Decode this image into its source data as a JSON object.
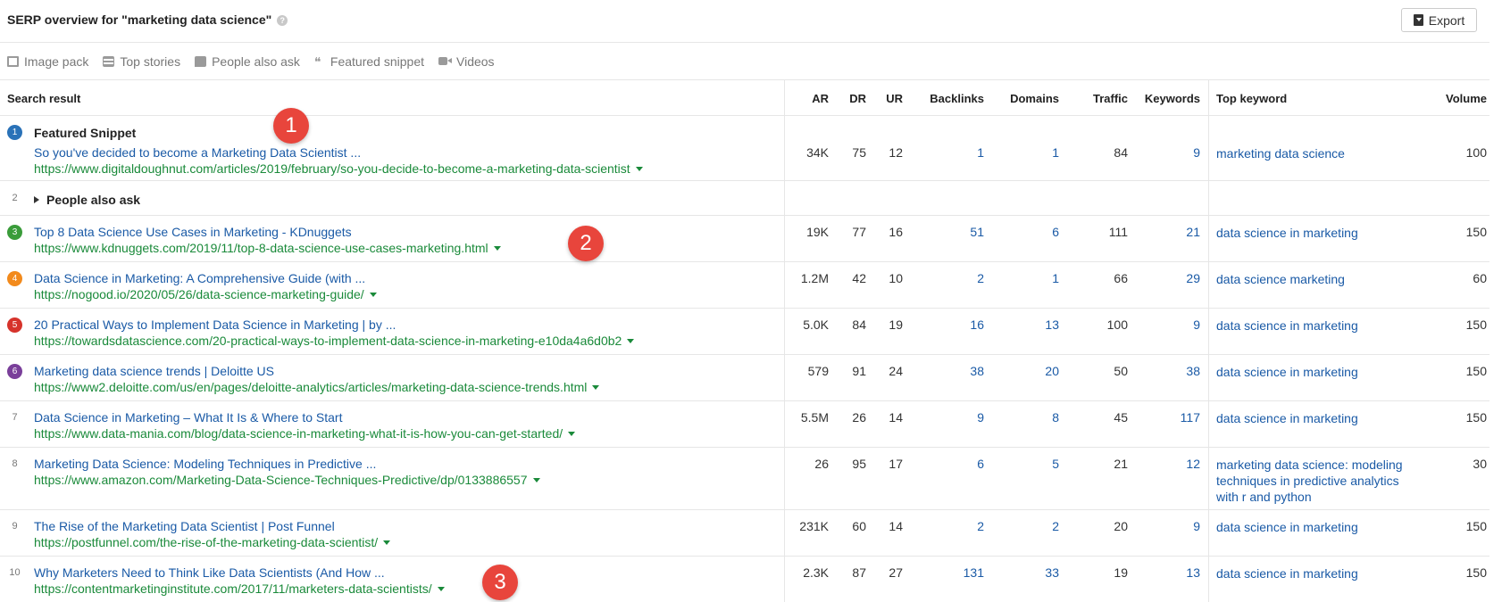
{
  "header": {
    "title": "SERP overview for \"marketing data science\"",
    "help": "?",
    "export_label": "Export"
  },
  "features": [
    {
      "label": "Image pack",
      "icon": "image-icon"
    },
    {
      "label": "Top stories",
      "icon": "stories-icon"
    },
    {
      "label": "People also ask",
      "icon": "question-icon"
    },
    {
      "label": "Featured snippet",
      "icon": "quote-icon"
    },
    {
      "label": "Videos",
      "icon": "video-icon"
    }
  ],
  "columns": {
    "search_result": "Search result",
    "ar": "AR",
    "dr": "DR",
    "ur": "UR",
    "backlinks": "Backlinks",
    "domains": "Domains",
    "traffic": "Traffic",
    "keywords": "Keywords",
    "top_keyword": "Top keyword",
    "volume": "Volume"
  },
  "featured_snippet_label": "Featured Snippet",
  "people_also_ask": {
    "position": "2",
    "label": "People also ask"
  },
  "rows": [
    {
      "pos": "1",
      "color": "#2a72b8",
      "title": "So you've decided to become a Marketing Data Scientist ...",
      "url": "https://www.digitaldoughnut.com/articles/2019/february/so-you-decide-to-become-a-marketing-data-scientist",
      "ar": "34K",
      "dr": "75",
      "ur": "12",
      "backlinks": "1",
      "domains": "1",
      "traffic": "84",
      "keywords": "9",
      "top_keyword": "marketing data science",
      "volume": "100"
    },
    {
      "pos": "3",
      "color": "#3a9c3a",
      "title": "Top 8 Data Science Use Cases in Marketing - KDnuggets",
      "url": "https://www.kdnuggets.com/2019/11/top-8-data-science-use-cases-marketing.html",
      "ar": "19K",
      "dr": "77",
      "ur": "16",
      "backlinks": "51",
      "domains": "6",
      "traffic": "111",
      "keywords": "21",
      "top_keyword": "data science in marketing",
      "volume": "150"
    },
    {
      "pos": "4",
      "color": "#f28a1c",
      "title": "Data Science in Marketing: A Comprehensive Guide (with ...",
      "url": "https://nogood.io/2020/05/26/data-science-marketing-guide/",
      "ar": "1.2M",
      "dr": "42",
      "ur": "10",
      "backlinks": "2",
      "domains": "1",
      "traffic": "66",
      "keywords": "29",
      "top_keyword": "data science marketing",
      "volume": "60"
    },
    {
      "pos": "5",
      "color": "#d6332b",
      "title": "20 Practical Ways to Implement Data Science in Marketing | by ...",
      "url": "https://towardsdatascience.com/20-practical-ways-to-implement-data-science-in-marketing-e10da4a6d0b2",
      "ar": "5.0K",
      "dr": "84",
      "ur": "19",
      "backlinks": "16",
      "domains": "13",
      "traffic": "100",
      "keywords": "9",
      "top_keyword": "data science in marketing",
      "volume": "150"
    },
    {
      "pos": "6",
      "color": "#7a3f9a",
      "title": "Marketing data science trends | Deloitte US",
      "url": "https://www2.deloitte.com/us/en/pages/deloitte-analytics/articles/marketing-data-science-trends.html",
      "ar": "579",
      "dr": "91",
      "ur": "24",
      "backlinks": "38",
      "domains": "20",
      "traffic": "50",
      "keywords": "38",
      "top_keyword": "data science in marketing",
      "volume": "150"
    },
    {
      "pos": "7",
      "color": "",
      "title": "Data Science in Marketing – What It Is & Where to Start",
      "url": "https://www.data-mania.com/blog/data-science-in-marketing-what-it-is-how-you-can-get-started/",
      "ar": "5.5M",
      "dr": "26",
      "ur": "14",
      "backlinks": "9",
      "domains": "8",
      "traffic": "45",
      "keywords": "117",
      "top_keyword": "data science in marketing",
      "volume": "150"
    },
    {
      "pos": "8",
      "color": "",
      "title": "Marketing Data Science: Modeling Techniques in Predictive ...",
      "url": "https://www.amazon.com/Marketing-Data-Science-Techniques-Predictive/dp/0133886557",
      "ar": "26",
      "dr": "95",
      "ur": "17",
      "backlinks": "6",
      "domains": "5",
      "traffic": "21",
      "keywords": "12",
      "top_keyword": "marketing data science: modeling techniques in predictive analytics with r and python",
      "volume": "30"
    },
    {
      "pos": "9",
      "color": "",
      "title": "The Rise of the Marketing Data Scientist | Post Funnel",
      "url": "https://postfunnel.com/the-rise-of-the-marketing-data-scientist/",
      "ar": "231K",
      "dr": "60",
      "ur": "14",
      "backlinks": "2",
      "domains": "2",
      "traffic": "20",
      "keywords": "9",
      "top_keyword": "data science in marketing",
      "volume": "150"
    },
    {
      "pos": "10",
      "color": "",
      "title": "Why Marketers Need to Think Like Data Scientists (And How ...",
      "url": "https://contentmarketinginstitute.com/2017/11/marketers-data-scientists/",
      "ar": "2.3K",
      "dr": "87",
      "ur": "27",
      "backlinks": "131",
      "domains": "33",
      "traffic": "19",
      "keywords": "13",
      "top_keyword": "data science in marketing",
      "volume": "150"
    }
  ],
  "annotations": [
    "1",
    "2",
    "3"
  ],
  "colors": {
    "title_link": "#1a5aa6",
    "url": "#1a8a3a",
    "badge": "#e8453c"
  }
}
